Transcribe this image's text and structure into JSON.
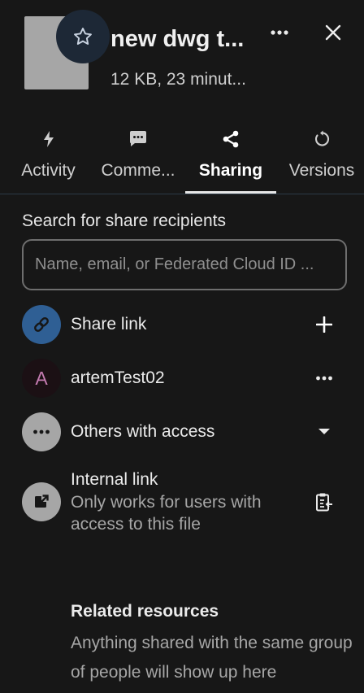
{
  "header": {
    "title": "new dwg t...",
    "subtitle": "12 KB, 23 minut..."
  },
  "tabs": [
    {
      "label": "Activity",
      "icon": "lightning-icon"
    },
    {
      "label": "Comme...",
      "icon": "comment-icon"
    },
    {
      "label": "Sharing",
      "icon": "share-icon",
      "active": true
    },
    {
      "label": "Versions",
      "icon": "history-icon"
    }
  ],
  "sharing": {
    "search_label": "Search for share recipients",
    "search_placeholder": "Name, email, or Federated Cloud ID ...",
    "share_link_label": "Share link",
    "user_initial": "A",
    "user_name": "artemTest02",
    "others_label": "Others with access",
    "internal_link_title": "Internal link",
    "internal_link_desc": "Only works for users with access to this file"
  },
  "related": {
    "title": "Related resources",
    "description": "Anything shared with the same group of people will show up here"
  },
  "colors": {
    "background": "#171717",
    "share_link_avatar": "#2f5f94",
    "user_avatar_bg": "#1b1014",
    "user_avatar_text": "#c47bb0",
    "grey_avatar": "#a6a6a6",
    "active_tab_underline": "#e6e6e6"
  }
}
